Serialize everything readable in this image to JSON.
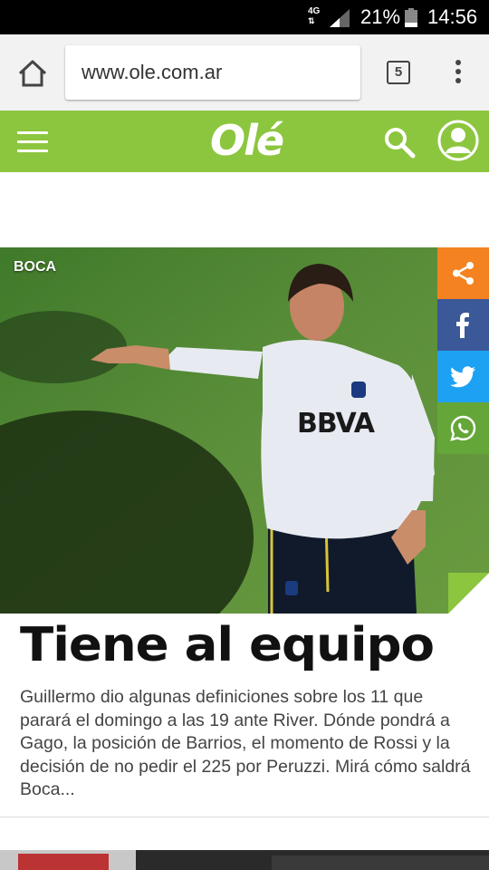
{
  "status_bar": {
    "network": "4G",
    "battery_percent": "21%",
    "time": "14:56",
    "icons": [
      "network-arrows-icon",
      "signal-icon",
      "battery-icon"
    ]
  },
  "browser": {
    "url": "www.ole.com.ar",
    "tab_count": "5",
    "page_load_progress": 0.9,
    "icons": [
      "home-icon",
      "tabs-icon",
      "more-vert-icon"
    ]
  },
  "site": {
    "logo_text": "Olé",
    "brand_color": "#8cc63f",
    "icons": [
      "menu-icon",
      "search-icon",
      "user-icon"
    ]
  },
  "article": {
    "section": "BOCA",
    "title": "Tiene al equipo",
    "summary": "Guillermo dio algunas definiciones sobre los 11 que parará el domingo a las 19 ante River. Dónde pondrá a Gago, la posición de Barrios, el momento de Rossi y la decisión de no pedir el 225 por Peruzzi. Mirá cómo saldrá Boca...",
    "image_text": "BBVA",
    "share_buttons": [
      {
        "name": "share-icon",
        "color": "#f58220"
      },
      {
        "name": "facebook-icon",
        "color": "#3b5998"
      },
      {
        "name": "twitter-icon",
        "color": "#1da1f2"
      },
      {
        "name": "whatsapp-icon",
        "color": "#65a639"
      }
    ]
  }
}
